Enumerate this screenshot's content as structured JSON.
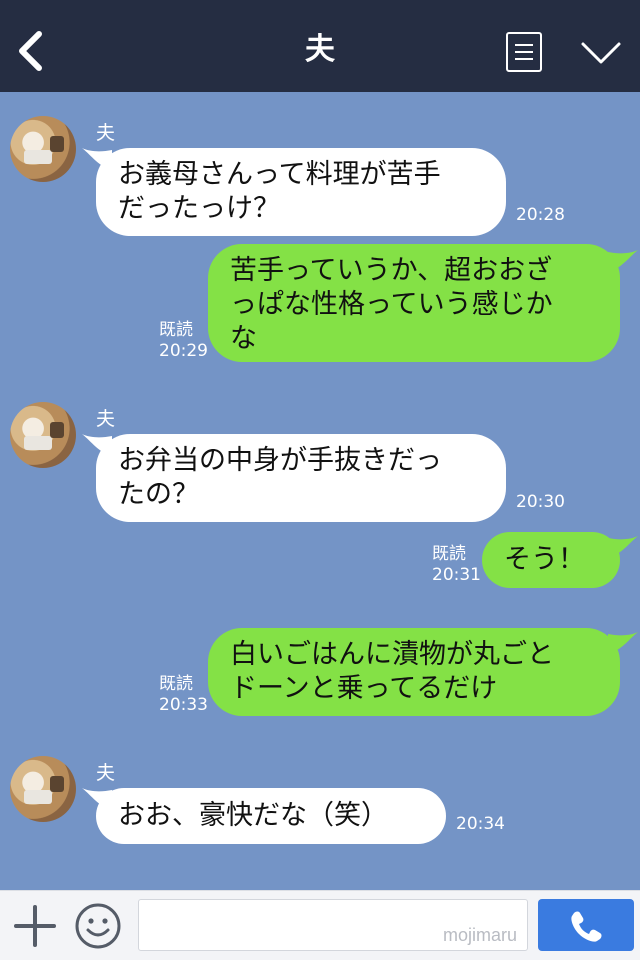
{
  "header": {
    "title": "夫",
    "back_icon": "chevron-left-icon",
    "menu_icon": "list-menu-icon",
    "collapse_icon": "chevron-down-icon"
  },
  "messages": [
    {
      "side": "left",
      "sender": "夫",
      "lines": [
        "お義母さんって料理が苦手",
        "だったっけ？"
      ],
      "time": "20:28"
    },
    {
      "side": "right",
      "read": "既読",
      "lines": [
        "苦手っていうか、超おおざ",
        "っぱな性格っていう感じか",
        "な"
      ],
      "time": "20:29"
    },
    {
      "side": "left",
      "sender": "夫",
      "lines": [
        "お弁当の中身が手抜きだっ",
        "たの？"
      ],
      "time": "20:30"
    },
    {
      "side": "right",
      "read": "既読",
      "lines": [
        "そう！"
      ],
      "time": "20:31"
    },
    {
      "side": "right",
      "read": "既読",
      "lines": [
        "白いごはんに漬物が丸ごと",
        "ドーンと乗ってるだけ"
      ],
      "time": "20:33"
    },
    {
      "side": "left",
      "sender": "夫",
      "lines": [
        "おお、豪快だな（笑）"
      ],
      "time": "20:34"
    }
  ],
  "footer": {
    "plus_icon": "plus-icon",
    "emoji_icon": "smiley-icon",
    "input_value": "",
    "watermark": "mojimaru",
    "call_icon": "phone-icon"
  },
  "colors": {
    "header_bg": "#252d42",
    "chat_bg": "#7494c6",
    "bubble_left": "#ffffff",
    "bubble_right": "#84e146",
    "call_button": "#3a7be0"
  }
}
